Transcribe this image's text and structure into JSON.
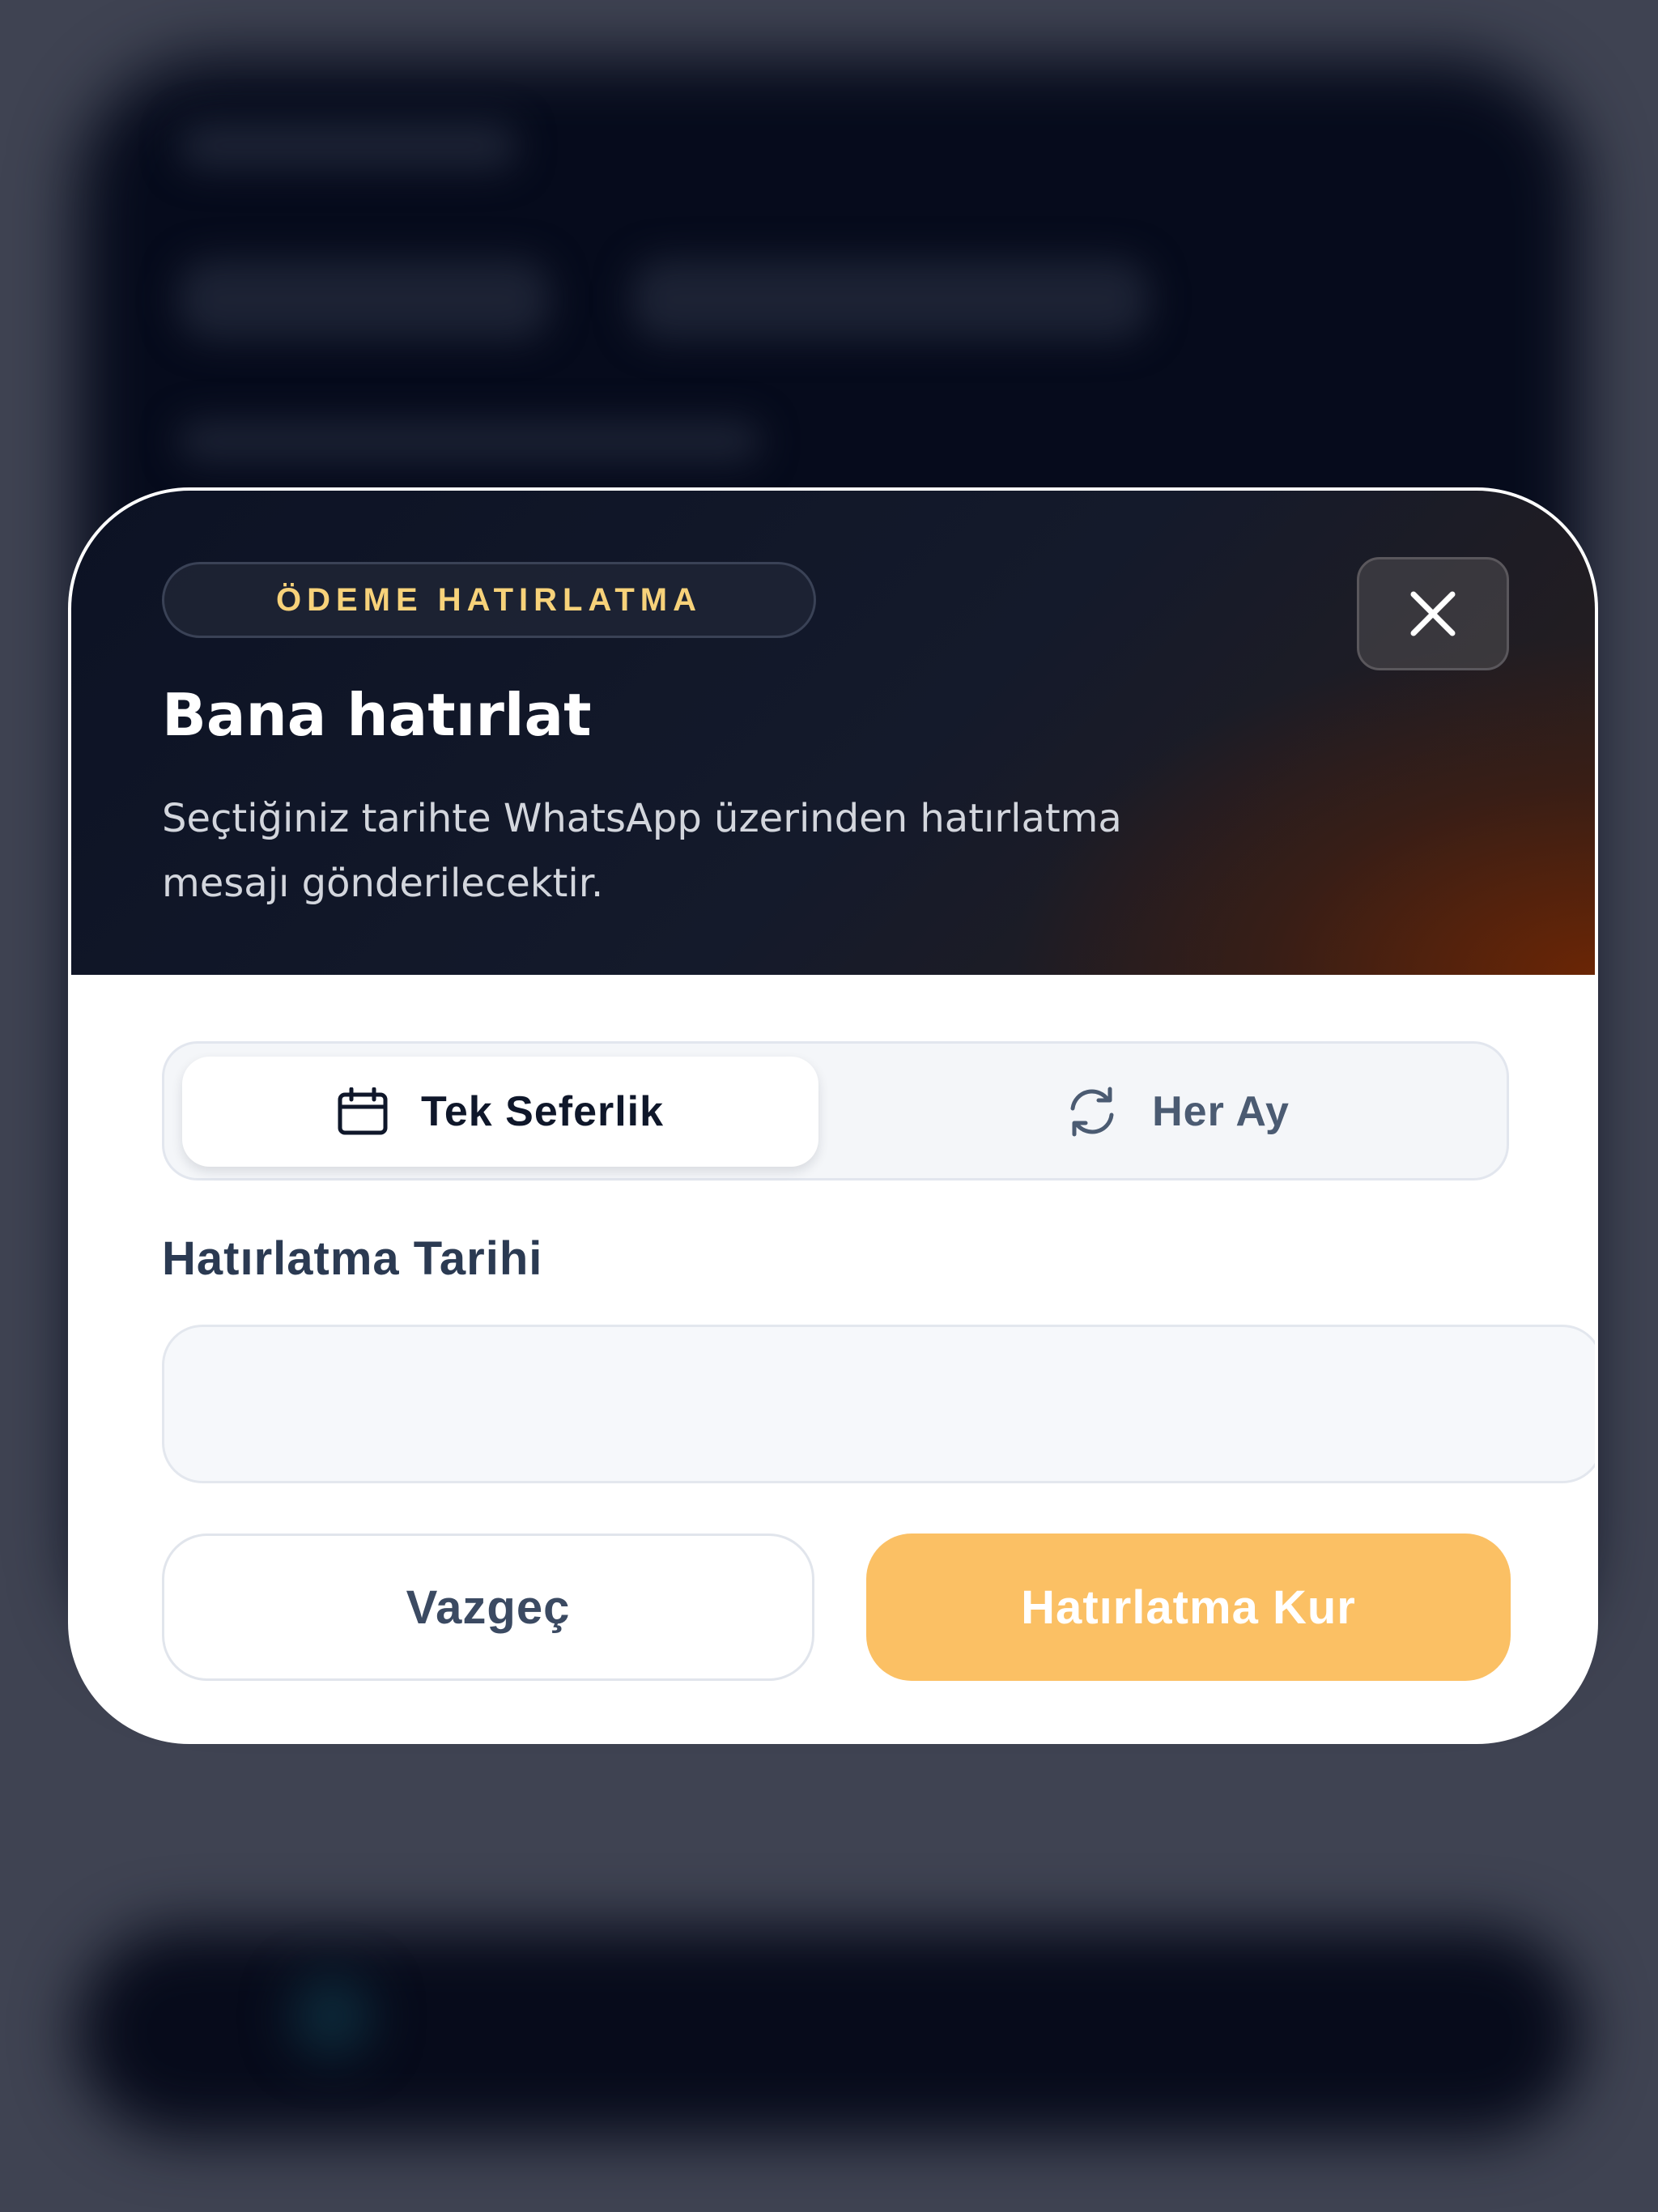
{
  "modal": {
    "badge": "ÖDEME HATIRLATMA",
    "title": "Bana hatırlat",
    "description": "Seçtiğiniz tarihte WhatsApp üzerinden hatırlatma mesajı gönderilecektir.",
    "close_icon": "close-icon"
  },
  "frequency": {
    "options": [
      {
        "label": "Tek Seferlik",
        "icon": "calendar-icon",
        "selected": true
      },
      {
        "label": "Her Ay",
        "icon": "refresh-icon",
        "selected": false
      }
    ]
  },
  "date_field": {
    "label": "Hatırlatma Tarihi",
    "value": ""
  },
  "actions": {
    "cancel_label": "Vazgeç",
    "submit_label": "Hatırlatma Kur"
  },
  "colors": {
    "accent": "#fbc064",
    "badge_text": "#f7d27a",
    "header_dark": "#0c1224"
  }
}
